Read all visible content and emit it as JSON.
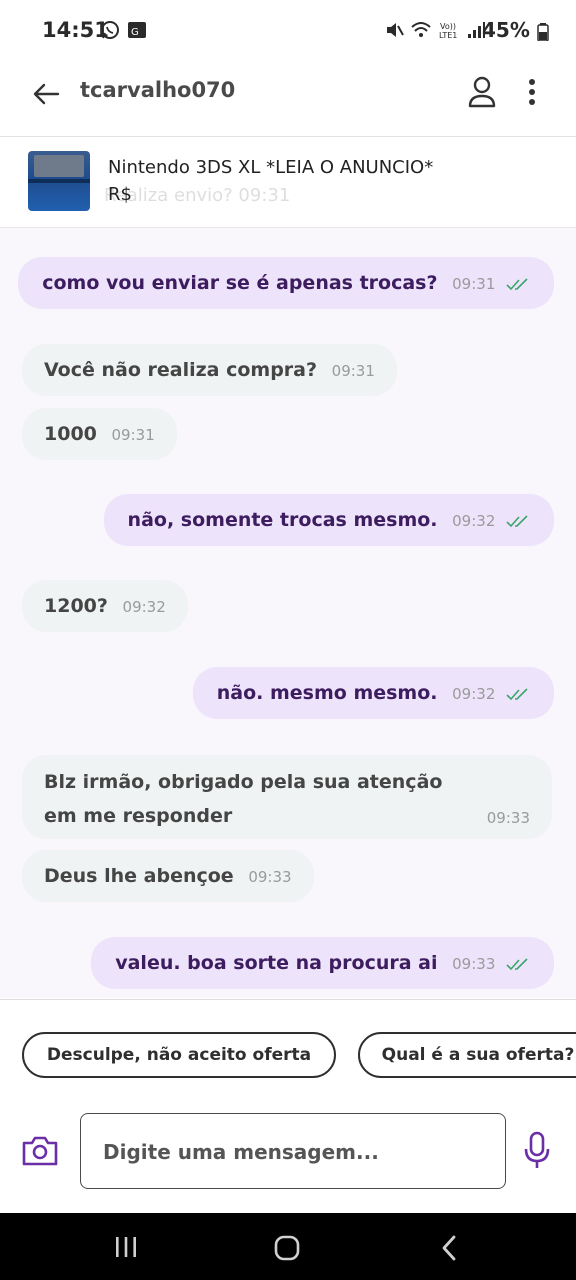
{
  "status_bar": {
    "time": "14:51",
    "battery": "45%",
    "left_icons": [
      "whatsapp-icon",
      "gallery-icon"
    ],
    "right_icons": [
      "mute-icon",
      "wifi-icon",
      "volte-icon",
      "signal-icon",
      "battery-icon"
    ]
  },
  "header": {
    "contact_name": "tcarvalho070",
    "icons": [
      "back-arrow-icon",
      "profile-icon",
      "more-vert-icon"
    ]
  },
  "product": {
    "title": "Nintendo 3DS XL *LEIA O ANUNCIO*",
    "price": "R$",
    "ghost_text": "Realiza envio? 09:31"
  },
  "messages": [
    {
      "direction": "out",
      "text": "como vou enviar se é apenas trocas?",
      "time": "09:31"
    },
    {
      "direction": "in",
      "text": "Você não realiza compra?",
      "time": "09:31"
    },
    {
      "direction": "in",
      "text": "1000",
      "time": "09:31"
    },
    {
      "direction": "out",
      "text": "não, somente trocas mesmo.",
      "time": "09:32"
    },
    {
      "direction": "in",
      "text": "1200?",
      "time": "09:32"
    },
    {
      "direction": "out",
      "text": "não. mesmo mesmo.",
      "time": "09:32"
    },
    {
      "direction": "in",
      "text": "Blz irmão, obrigado pela sua atenção em me responder",
      "time": "09:33"
    },
    {
      "direction": "in",
      "text": "Deus lhe abençoe",
      "time": "09:33"
    },
    {
      "direction": "out",
      "text": "valeu. boa sorte na procura ai",
      "time": "09:33"
    }
  ],
  "quick_replies": [
    "Desculpe, não aceito oferta",
    "Qual é a sua oferta?"
  ],
  "input": {
    "placeholder": "Digite uma mensagem..."
  },
  "colors": {
    "accent": "#6a2ea6",
    "outgoing_bubble": "#ede4fb",
    "incoming_bubble": "#f0f3f3",
    "read_ticks": "#3aa56b"
  },
  "nav_bar": {
    "icons": [
      "recents-icon",
      "home-icon",
      "back-icon"
    ]
  }
}
